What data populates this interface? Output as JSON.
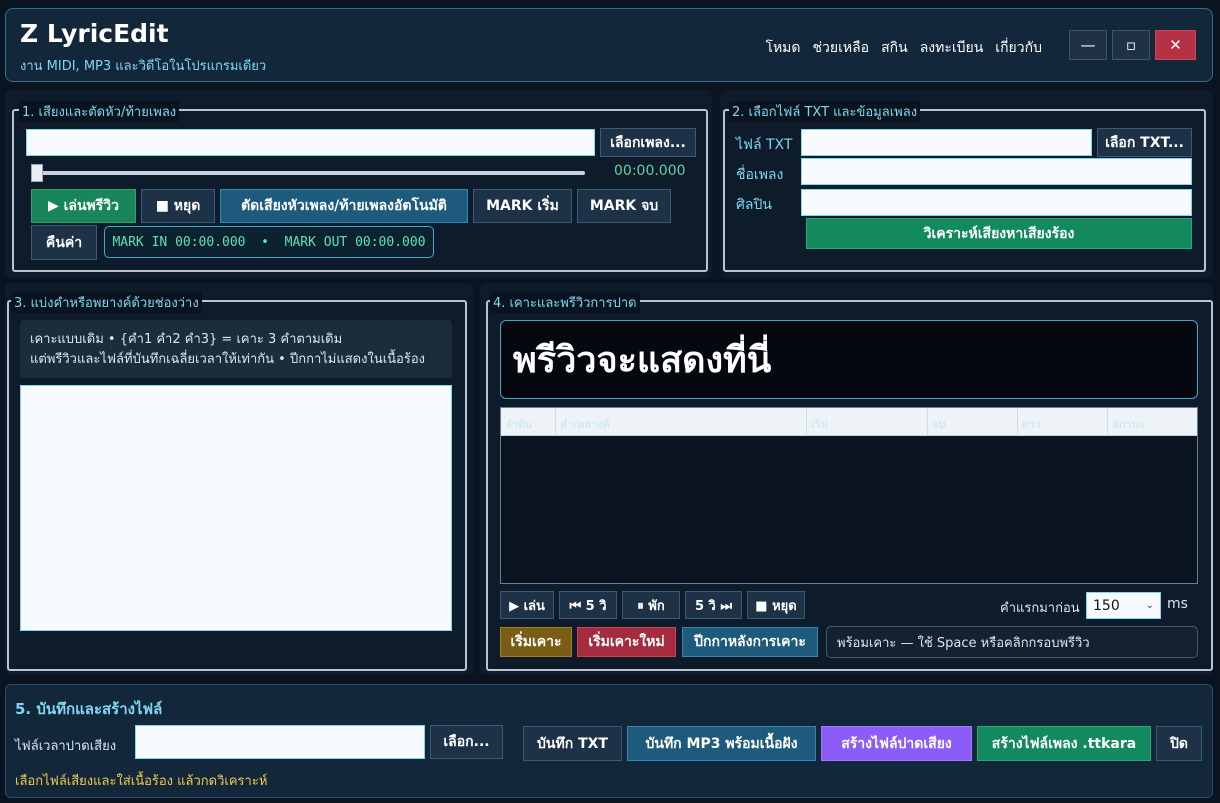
{
  "app": {
    "title": "Z LyricEdit",
    "subtitle": "งาน MIDI, MP3 และวิดีโอในโปรแกรมเดียว",
    "menu": [
      "โหมด",
      "ช่วยเหลือ",
      "สกิน",
      "ลงทะเบียน",
      "เกี่ยวกับ"
    ],
    "window": {
      "minimize": "—",
      "maximize": "▫",
      "close": "✕"
    }
  },
  "section1": {
    "title": "1. เสียงและตัดหัว/ท้ายเพลง",
    "song_path": "",
    "choose_song": "เลือกเพลง...",
    "time": "00:00.000",
    "slider_position": 0,
    "play_preview": "▶ เล่นพรีวิว",
    "stop": "■ หยุด",
    "auto_trim": "ตัดเสียงหัวเพลง/ท้ายเพลงอัตโนมัติ",
    "mark_start": "MARK เริ่ม",
    "mark_end": "MARK จบ",
    "restore": "คืนค่า",
    "mark_readout": "MARK IN 00:00.000  •  MARK OUT 00:00.000"
  },
  "section2": {
    "title": "2. เลือกไฟล์ TXT และข้อมูลเพลง",
    "txt_label": "ไฟล์ TXT",
    "txt_value": "",
    "choose_txt": "เลือก TXT...",
    "song_name_label": "ชื่อเพลง",
    "song_name_value": "",
    "artist_label": "ศิลปิน",
    "artist_value": "",
    "analyze": "วิเคราะห์เสียงหาเสียงร้อง"
  },
  "section3": {
    "title": "3. แบ่งคำหรือพยางค์ด้วยช่องว่าง",
    "hint_line1": "เคาะแบบเดิม • {คำ1 คำ2 คำ3} = เคาะ 3 คำตามเดิม",
    "hint_line2": "แต่พรีวิวและไฟล์ที่บันทึกเฉลี่ยเวลาให้เท่ากัน • ปีกกาไม่แสดงในเนื้อร้อง",
    "lyrics_text": ""
  },
  "section4": {
    "title": "4. เคาะและพรีวิวการปาด",
    "preview_text": "พรีวิวจะแสดงที่นี่",
    "table_columns": [
      "ลำดับ",
      "คำ/พยางค์",
      "เริ่ม",
      "จบ",
      "ยาว",
      "สถานะ"
    ],
    "controls": {
      "play": "▶ เล่น",
      "back5": "⏮ 5 วิ",
      "pause": "⏸ พัก",
      "fwd5": "5 วิ ⏭",
      "stop": "■ หยุด"
    },
    "lead_label": "คำแรกมาก่อน",
    "lead_value": "150",
    "lead_unit": "ms",
    "start_tap": "เริ่มเคาะ",
    "restart_tap": "เริ่มเคาะใหม่",
    "post_brace": "ปีกกาหลังการเคาะ",
    "status": "พร้อมเคาะ — ใช้ Space หรือคลิกกรอบพรีวิว"
  },
  "section5": {
    "title": "5. บันทึกและสร้างไฟล์",
    "timing_label": "ไฟล์เวลาปาดเสียง",
    "timing_value": "",
    "choose": "เลือก...",
    "save_txt": "บันทึก TXT",
    "save_mp3": "บันทึก MP3 พร้อมเนื้อฝัง",
    "make_timing": "สร้างไฟล์ปาดเสียง",
    "make_ttkara": "สร้างไฟล์เพลง .ttkara",
    "close": "ปิด",
    "status": "เลือกไฟล์เสียงและใส่เนื้อร้อง แล้วกดวิเคราะห์"
  }
}
